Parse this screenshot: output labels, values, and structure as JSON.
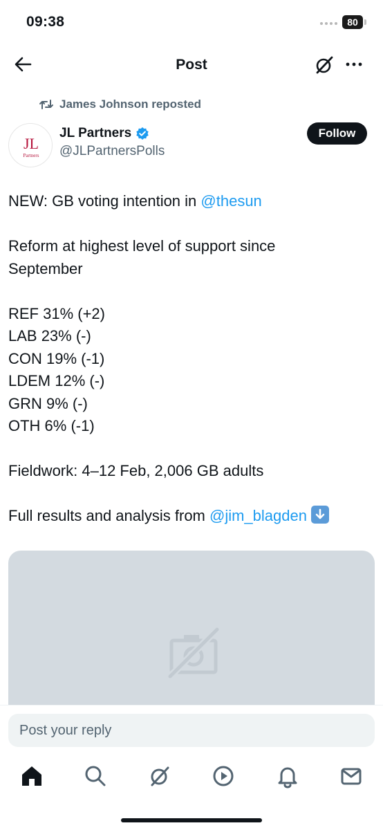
{
  "status_bar": {
    "time": "09:38",
    "battery": "80"
  },
  "header": {
    "title": "Post",
    "back_icon": "arrow-left-icon",
    "grok_icon": "grok-icon",
    "more_icon": "more-dots-icon"
  },
  "repost": {
    "text": "James Johnson reposted",
    "icon": "repost-icon"
  },
  "author": {
    "name": "JL Partners",
    "handle": "@JLPartnersPolls",
    "verified": true,
    "avatar_logo": "JL",
    "avatar_sub": "Partners",
    "follow_label": "Follow"
  },
  "post": {
    "intro": "NEW: GB voting intention in ",
    "intro_mention": "@thesun",
    "headline_1": "Reform at highest level of support since",
    "headline_2": "September",
    "results": [
      "REF 31% (+2)",
      "LAB 23% (-)",
      "CON 19% (-1)",
      "LDEM 12% (-)",
      "GRN 9% (-)",
      "OTH 6% (-1)"
    ],
    "fieldwork": "Fieldwork: 4–12 Feb, 2,006 GB adults",
    "full_results": "Full results and analysis from ",
    "full_results_mention": "@jim_blagden",
    "emoji": "down-arrow-emoji"
  },
  "media": {
    "icon": "image-unavailable-icon"
  },
  "reply": {
    "placeholder": "Post your reply"
  },
  "colors": {
    "accent": "#1d9bf0",
    "text": "#0f1419",
    "muted": "#536471",
    "media_bg": "#d3dae0",
    "brand": "#b5123a"
  },
  "bottom_nav": [
    "home-icon",
    "search-icon",
    "grok-icon",
    "video-icon",
    "notifications-icon",
    "messages-icon"
  ]
}
